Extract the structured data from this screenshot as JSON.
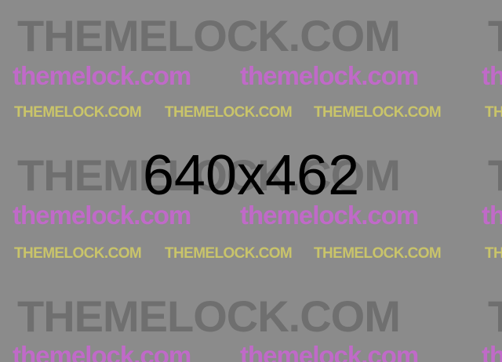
{
  "placeholder": {
    "dimensions_label": "640x462"
  },
  "watermark": {
    "large_text": "THEMELOCK.COM",
    "medium_text": "themelock.com",
    "small_text": "THEMELOCK.COM"
  },
  "colors": {
    "background": "#8b8b8b",
    "watermark_gray": "#6f6f6f",
    "watermark_pink": "#c06ac8",
    "watermark_yellow": "#c9c46a",
    "label": "#000000"
  }
}
